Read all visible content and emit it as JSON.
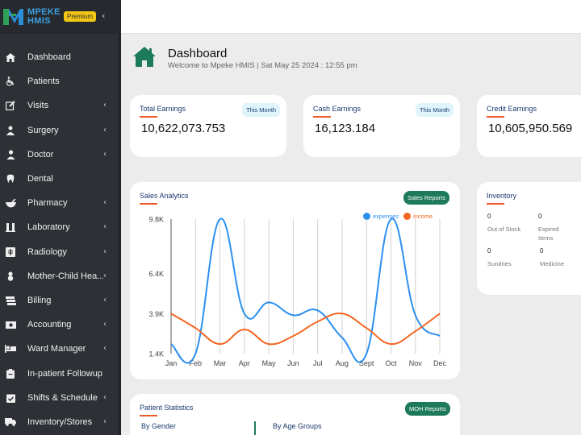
{
  "app": {
    "brand_line1": "MPEKE",
    "brand_line2": "HMIS",
    "badge": "Premium",
    "collapse_glyph": "‹"
  },
  "sidebar": {
    "items": [
      {
        "label": "Dashboard",
        "icon": "home-icon",
        "has_submenu": false
      },
      {
        "label": "Patients",
        "icon": "wheelchair-icon",
        "has_submenu": false
      },
      {
        "label": "Visits",
        "icon": "edit-icon",
        "has_submenu": true
      },
      {
        "label": "Surgery",
        "icon": "surgeon-icon",
        "has_submenu": true
      },
      {
        "label": "Doctor",
        "icon": "doctor-icon",
        "has_submenu": true
      },
      {
        "label": "Dental",
        "icon": "tooth-icon",
        "has_submenu": false
      },
      {
        "label": "Pharmacy",
        "icon": "mortar-icon",
        "has_submenu": true
      },
      {
        "label": "Laboratory",
        "icon": "lab-icon",
        "has_submenu": true
      },
      {
        "label": "Radiology",
        "icon": "xray-icon",
        "has_submenu": true
      },
      {
        "label": "Mother-Child Hea...",
        "icon": "baby-icon",
        "has_submenu": true
      },
      {
        "label": "Billing",
        "icon": "money-icon",
        "has_submenu": true
      },
      {
        "label": "Accounting",
        "icon": "cash-icon",
        "has_submenu": true
      },
      {
        "label": "Ward Manager",
        "icon": "bed-icon",
        "has_submenu": true
      },
      {
        "label": "In-patient Followup",
        "icon": "clipboard-icon",
        "has_submenu": false
      },
      {
        "label": "Shifts & Schedule",
        "icon": "calendar-check-icon",
        "has_submenu": true
      },
      {
        "label": "Inventory/Stores",
        "icon": "truck-icon",
        "has_submenu": true
      }
    ],
    "chevron": "‹"
  },
  "header": {
    "title": "Dashboard",
    "subtitle": "Welcome to Mpeke HMIS | Sat May 25 2024 : 12:55 pm"
  },
  "earnings": {
    "total": {
      "title": "Total Earnings",
      "value": "10,622,073.753",
      "pill": "This Month"
    },
    "cash": {
      "title": "Cash Earnings",
      "value": "16,123.184",
      "pill": "This Month"
    },
    "credit": {
      "title": "Credit Earnings",
      "value": "10,605,950.569"
    }
  },
  "sales": {
    "title": "Sales Analytics",
    "button": "Sales Reports"
  },
  "inventory": {
    "title": "Inventory",
    "items": [
      {
        "value": "0",
        "label": "Out of Stock"
      },
      {
        "value": "0",
        "label": "Expired Items"
      },
      {
        "value": "0",
        "label": "Sundries"
      },
      {
        "value": "0",
        "label": "Medicine"
      }
    ]
  },
  "patient_stats": {
    "title": "Patient Statistics",
    "button": "MOH Reports",
    "by_gender": "By Gender",
    "by_age": "By Age Groups"
  },
  "colors": {
    "expenses": "#2b8ff0",
    "income": "#f4651f",
    "accent_green": "#1e7a5c",
    "underline": "#f05a28"
  },
  "chart_data": {
    "type": "line",
    "title": "Sales Analytics",
    "categories": [
      "Jan",
      "Feb",
      "Mar",
      "Apr",
      "May",
      "Jun",
      "Jul",
      "Aug",
      "Sept",
      "Oct",
      "Nov",
      "Dec"
    ],
    "series": [
      {
        "name": "expenses",
        "values": [
          2.0,
          1.4,
          9.8,
          3.9,
          4.6,
          3.8,
          4.1,
          2.4,
          1.4,
          9.8,
          3.8,
          2.5
        ]
      },
      {
        "name": "income",
        "values": [
          3.9,
          3.0,
          2.0,
          2.9,
          2.0,
          2.5,
          3.4,
          3.9,
          3.0,
          2.0,
          2.8,
          3.9
        ]
      }
    ],
    "yticks": [
      "1.4K",
      "3.9K",
      "6.4K",
      "9.8K"
    ],
    "ytick_values": [
      1.4,
      3.9,
      6.4,
      9.8
    ],
    "ylim": [
      1.4,
      9.8
    ],
    "legend": "top-right",
    "grid": "vertical"
  }
}
